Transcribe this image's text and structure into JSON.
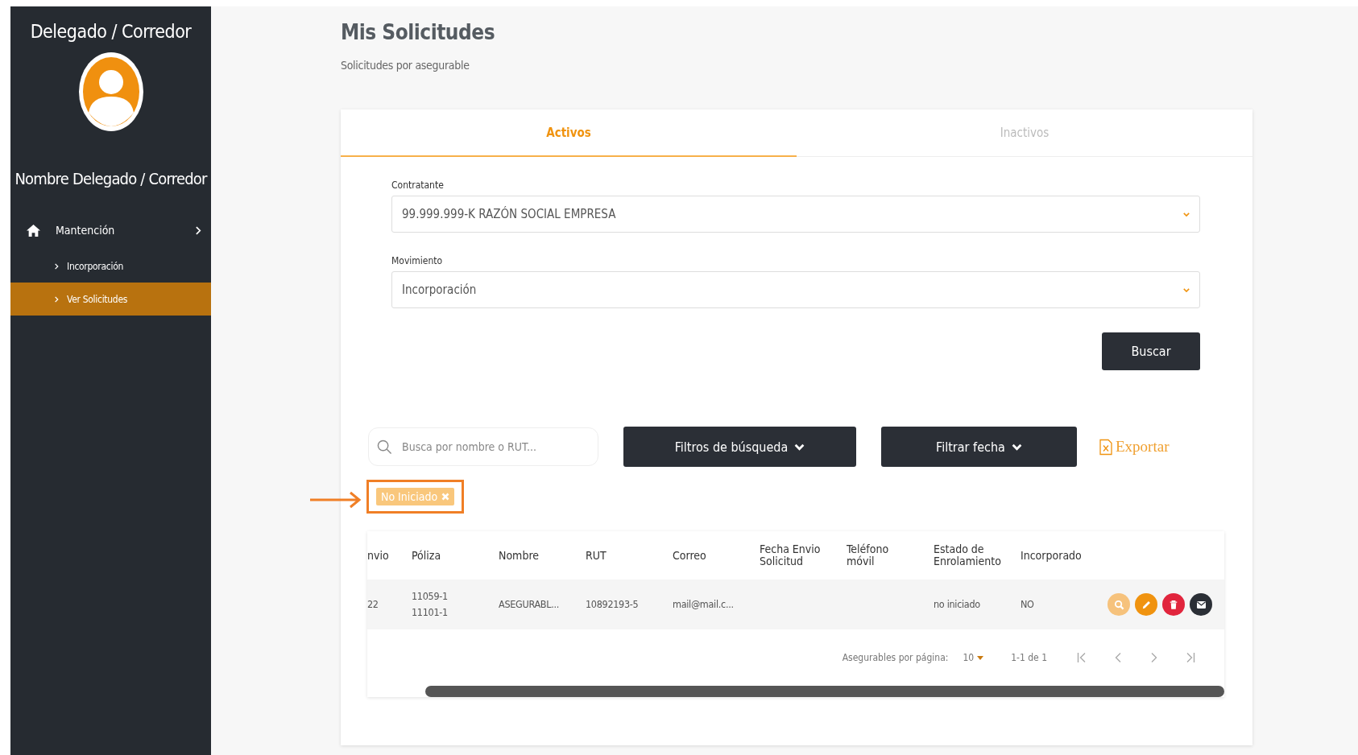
{
  "sidebar": {
    "title": "Delegado / Corredor",
    "user_name": "Nombre Delegado / Corredor",
    "menu": [
      {
        "label": "Mantención",
        "children": [
          {
            "label": "Incorporación",
            "selected": false
          },
          {
            "label": "Ver Solicitudes",
            "selected": true
          }
        ]
      }
    ]
  },
  "page": {
    "title": "Mis Solicitudes",
    "subtitle": "Solicitudes por asegurable"
  },
  "tabs": [
    {
      "label": "Activos",
      "selected": true
    },
    {
      "label": "Inactivos",
      "selected": false
    }
  ],
  "form": {
    "fields": [
      {
        "label": "Contratante",
        "value": "99.999.999-K RAZÓN SOCIAL EMPRESA"
      },
      {
        "label": "Movimiento",
        "value": "Incorporación"
      }
    ],
    "submit": "Buscar"
  },
  "toolbar": {
    "search": {
      "placeholder": "Busca por nombre o RUT..."
    },
    "buttons": [
      "Filtros de búsqueda",
      "Filtrar fecha"
    ],
    "export": "Exportar"
  },
  "active_filters": [
    {
      "label": "No Iniciado",
      "annotated": true
    }
  ],
  "table": {
    "columns": [
      {
        "lines": [
          "nvio"
        ]
      },
      {
        "lines": [
          "Póliza"
        ]
      },
      {
        "lines": [
          "Nombre"
        ]
      },
      {
        "lines": [
          "RUT"
        ]
      },
      {
        "lines": [
          "Correo"
        ]
      },
      {
        "lines": [
          "Fecha Envio",
          "Solicitud"
        ]
      },
      {
        "lines": [
          "Teléfono",
          "móvil"
        ]
      },
      {
        "lines": [
          "Estado de",
          "Enrolamiento"
        ]
      },
      {
        "lines": [
          "Incorporado"
        ]
      }
    ],
    "rows": [
      {
        "cells": [
          [
            "22"
          ],
          [
            "11059-1",
            "11101-1"
          ],
          [
            "ASEGURABL..."
          ],
          [
            "10892193-5"
          ],
          [
            "mail@mail.c..."
          ],
          null,
          null,
          [
            "no iniciado"
          ],
          [
            "NO"
          ]
        ],
        "actions": [
          {
            "kind": "view",
            "color": "#f6c27c"
          },
          {
            "kind": "edit",
            "color": "#f0930f"
          },
          {
            "kind": "delete",
            "color": "#e1253d"
          },
          {
            "kind": "email",
            "color": "#2b2f36"
          }
        ]
      }
    ],
    "pagination": {
      "per_page_label": "Asegurables por página:",
      "per_page": "10",
      "range": "1-1 de 1"
    }
  }
}
